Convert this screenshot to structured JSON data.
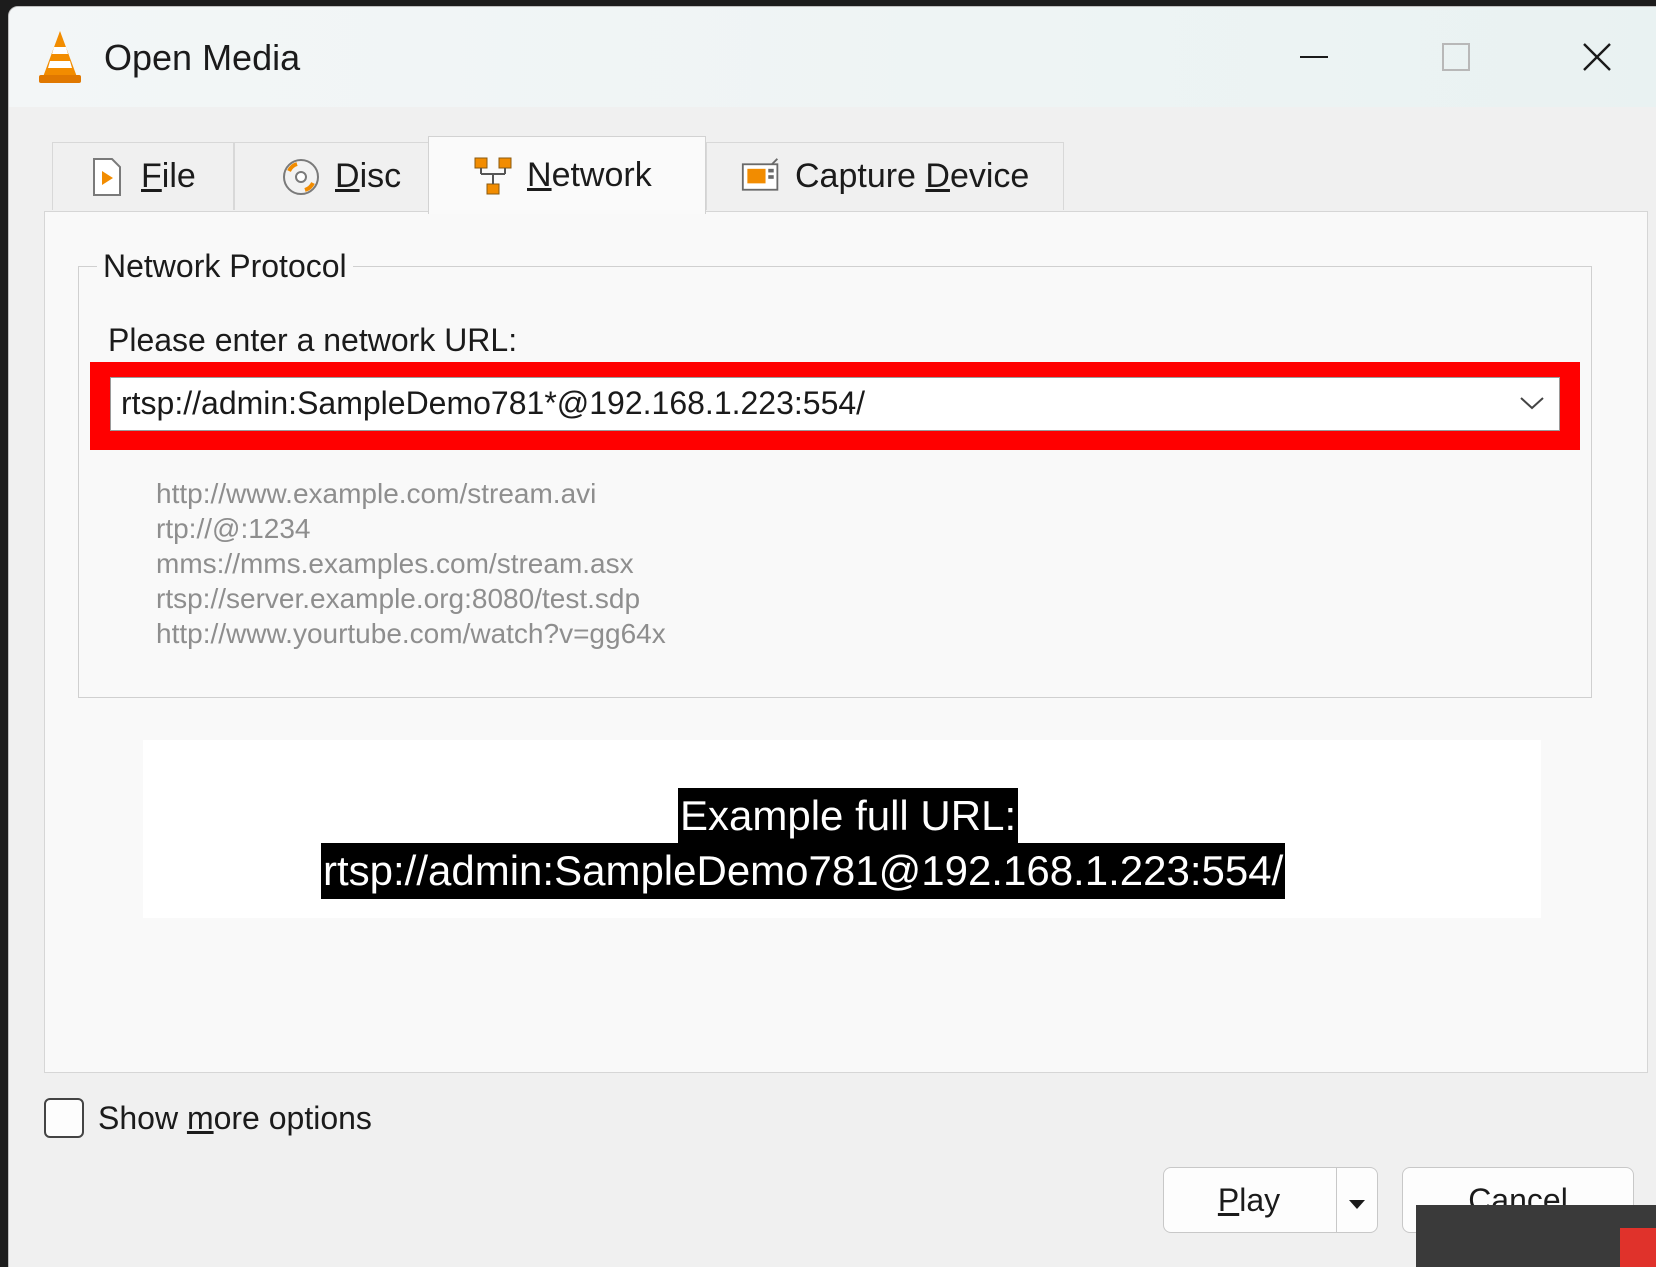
{
  "window": {
    "title": "Open Media",
    "minimize_label": "Minimize",
    "maximize_label": "Maximize",
    "close_label": "Close"
  },
  "tabs": [
    {
      "id": "file",
      "mnemonic": "F",
      "rest": "ile",
      "icon": "file-play-icon"
    },
    {
      "id": "disc",
      "mnemonic": "D",
      "rest": "isc",
      "icon": "disc-icon"
    },
    {
      "id": "network",
      "mnemonic": "N",
      "rest": "etwork",
      "icon": "network-icon",
      "active": true
    },
    {
      "id": "capture",
      "prefix": "Capture ",
      "mnemonic": "D",
      "rest": "evice",
      "icon": "capture-device-icon"
    }
  ],
  "network": {
    "group_label": "Network Protocol",
    "url_prompt": "Please enter a network URL:",
    "url_value": "rtsp://admin:SampleDemo781*@192.168.1.223:554/",
    "examples": [
      "http://www.example.com/stream.avi",
      "rtp://@:1234",
      "mms://mms.examples.com/stream.asx",
      "rtsp://server.example.org:8080/test.sdp",
      "http://www.yourtube.com/watch?v=gg64x"
    ]
  },
  "annotation": {
    "line1": "Example full URL:",
    "line2": "rtsp://admin:SampleDemo781@192.168.1.223:554/",
    "highlight_color": "#ff0000"
  },
  "options": {
    "pre": "Show ",
    "mnemonic": "m",
    "post": "ore options",
    "checked": false
  },
  "buttons": {
    "play_mnemonic": "P",
    "play_rest": "lay",
    "cancel_mnemonic": "C",
    "cancel_rest": "ancel"
  },
  "colors": {
    "vlc_orange": "#f28c00",
    "accent_red": "#ff0000",
    "watermark_red": "#e0322b"
  }
}
